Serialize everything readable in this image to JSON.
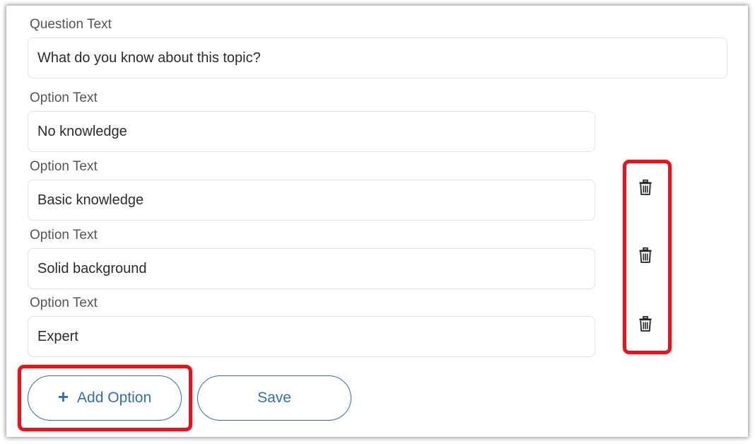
{
  "form": {
    "question": {
      "label": "Question Text",
      "value": "What do you know about this topic?"
    },
    "options": [
      {
        "label": "Option Text",
        "value": "No knowledge"
      },
      {
        "label": "Option Text",
        "value": "Basic knowledge"
      },
      {
        "label": "Option Text",
        "value": "Solid background"
      },
      {
        "label": "Option Text",
        "value": "Expert"
      }
    ]
  },
  "buttons": {
    "add_option_icon": "+",
    "add_option_label": "Add Option",
    "save_label": "Save"
  },
  "icons": {
    "delete": "trash-icon"
  },
  "colors": {
    "accent": "#2f6fae",
    "highlight": "#e8121c",
    "label": "#555555",
    "input_text": "#2b2b2b",
    "input_border": "#e2e2e2"
  }
}
